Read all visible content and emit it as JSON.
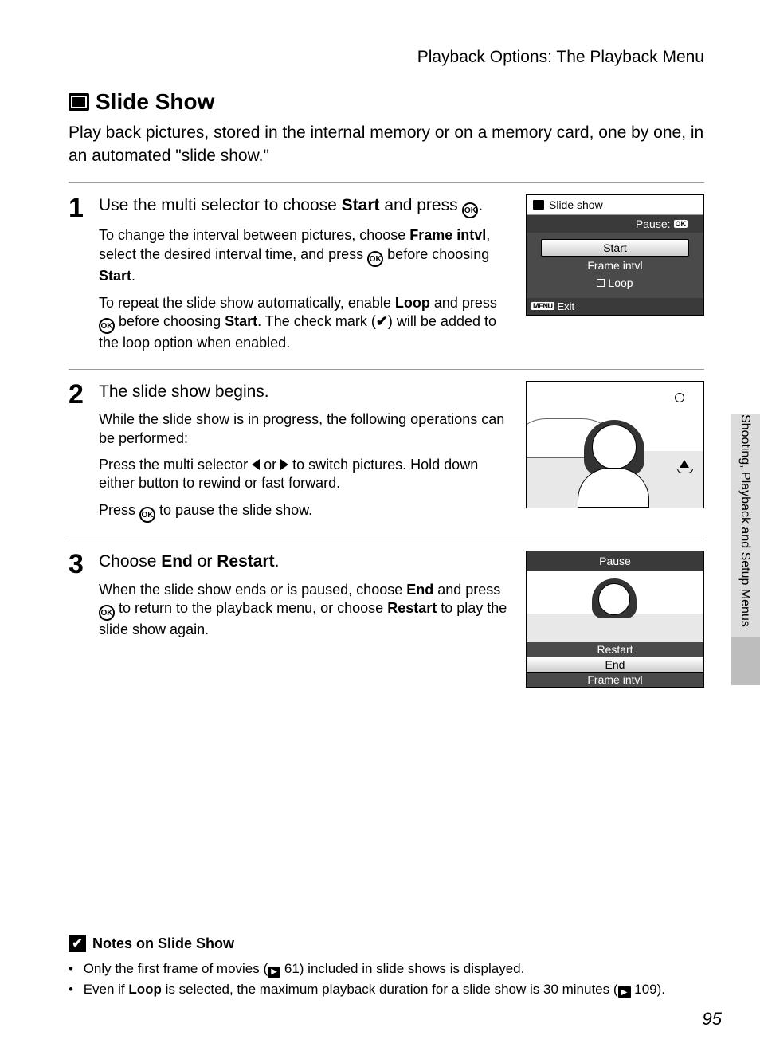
{
  "header": {
    "chapter": "Playback Options: The Playback Menu"
  },
  "title": "Slide Show",
  "intro": "Play back pictures, stored in the internal memory or on a memory card, one by one, in an automated \"slide show.\"",
  "steps": [
    {
      "num": "1",
      "heading_pre": "Use the multi selector to choose ",
      "heading_strong": "Start",
      "heading_post": " and press ",
      "heading_end": ".",
      "p1_pre": "To change the interval between pictures, choose ",
      "p1_s1": "Frame intvl",
      "p1_mid": ", select the desired interval time, and press ",
      "p1_post": " before choosing ",
      "p1_s2": "Start",
      "p1_end": ".",
      "p2_pre": "To repeat the slide show automatically, enable ",
      "p2_s1": "Loop",
      "p2_mid": " and press ",
      "p2_post": " before choosing ",
      "p2_s2": "Start",
      "p2_tail": ". The check mark (",
      "p2_tail2": ") will be added to the loop option when enabled."
    },
    {
      "num": "2",
      "heading": "The slide show begins.",
      "p1": "While the slide show is in progress, the following operations can be performed:",
      "p2_pre": "Press the multi selector ",
      "p2_mid": " or ",
      "p2_post": " to switch pictures. Hold down either button to rewind or fast forward.",
      "p3_pre": "Press ",
      "p3_post": " to pause the slide show."
    },
    {
      "num": "3",
      "heading_pre": "Choose ",
      "heading_s1": "End",
      "heading_mid": " or ",
      "heading_s2": "Restart",
      "heading_end": ".",
      "p1_pre": "When the slide show ends or is paused, choose ",
      "p1_s1": "End",
      "p1_mid": " and press ",
      "p1_post": " to return to the playback menu, or choose ",
      "p1_s2": "Restart",
      "p1_end": " to play the slide show again."
    }
  ],
  "figure1": {
    "title": "Slide show",
    "pause_label": "Pause:",
    "ok": "OK",
    "items": [
      "Start",
      "Frame intvl",
      "Loop"
    ],
    "selected_index": 0,
    "footer_menu": "MENU",
    "footer_exit": "Exit"
  },
  "figure3": {
    "header": "Pause",
    "items": [
      "Restart",
      "End",
      "Frame intvl"
    ],
    "selected_index": 1
  },
  "notes": {
    "title": "Notes on Slide Show",
    "items": [
      {
        "pre": "Only the first frame of movies (",
        "ref": "61",
        "post": ") included in slide shows is displayed."
      },
      {
        "pre": "Even if ",
        "strong": "Loop",
        "mid": " is selected, the maximum playback duration for a slide show is 30 minutes (",
        "ref": "109",
        "post": ")."
      }
    ]
  },
  "sidetab": "Shooting, Playback and Setup Menus",
  "pagenum": "95",
  "glyphs": {
    "ok": "OK",
    "check": "✔"
  }
}
